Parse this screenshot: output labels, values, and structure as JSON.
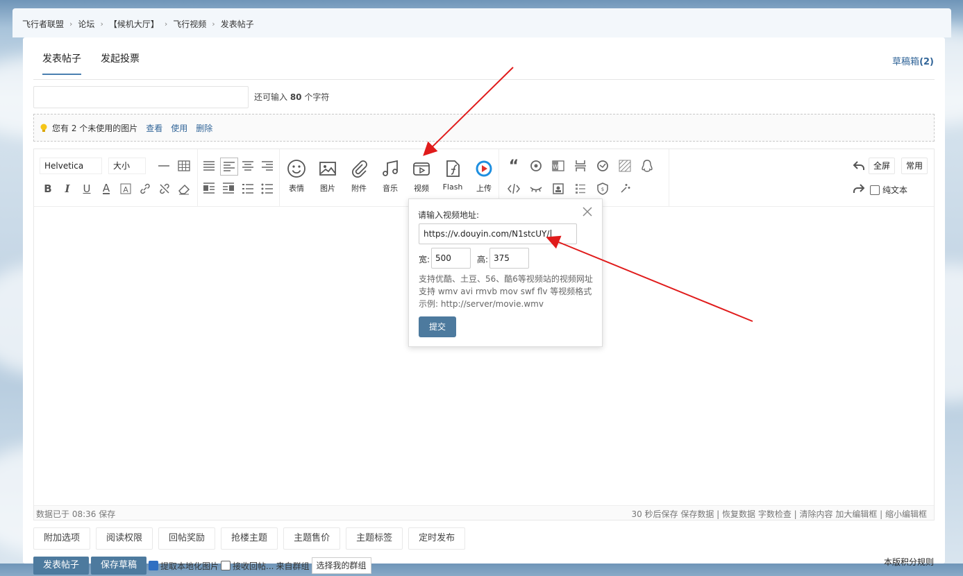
{
  "breadcrumb": [
    "飞行者联盟",
    "论坛",
    "【候机大厅】",
    "飞行视频",
    "发表帖子"
  ],
  "breadcrumb_sep": "›",
  "tabs": {
    "post": "发表帖子",
    "poll": "发起投票"
  },
  "drafts": {
    "label": "草稿箱",
    "count": "(2)"
  },
  "title": {
    "prefix": "还可输入 ",
    "count": "80",
    "suffix": " 个字符"
  },
  "notice": {
    "text": "您有 2 个未使用的图片",
    "view": "查看",
    "use": "使用",
    "delete": "删除"
  },
  "toolbar": {
    "font": "Helvetica",
    "size": "大小",
    "big_labels": [
      "表情",
      "图片",
      "附件",
      "音乐",
      "视频",
      "Flash",
      "上传"
    ],
    "fullscreen": "全屏",
    "common": "常用",
    "plain_text": "纯文本"
  },
  "status": {
    "saved": "数据已于 08:36 保存",
    "right": "30 秒后保存 保存数据 | 恢复数据   字数检查 | 清除内容   加大编辑框 | 缩小编辑框"
  },
  "video_popup": {
    "title": "请输入视频地址:",
    "url": "https://v.douyin.com/N1stcUY/",
    "width_label": "宽:",
    "width": "500",
    "height_label": "高:",
    "height": "375",
    "info1": "支持优酷、土豆、56、酷6等视频站的视频网址",
    "info2": "支持 wmv avi rmvb mov swf flv 等视频格式",
    "info3": "示例: http://server/movie.wmv",
    "submit": "提交"
  },
  "options": [
    "附加选项",
    "阅读权限",
    "回帖奖励",
    "抢楼主题",
    "主题售价",
    "主题标签",
    "定时发布"
  ],
  "bottom": {
    "post": "发表帖子",
    "save_draft": "保存草稿",
    "local_img": "提取本地化图片",
    "receive": "接收回帖...",
    "circle_label": "来自群组",
    "circle_select": "选择我的群组",
    "rules": "本版积分规则"
  },
  "colors": {
    "accent": "#4d7a9e",
    "link": "#336699",
    "arrow": "#e01b1b"
  }
}
